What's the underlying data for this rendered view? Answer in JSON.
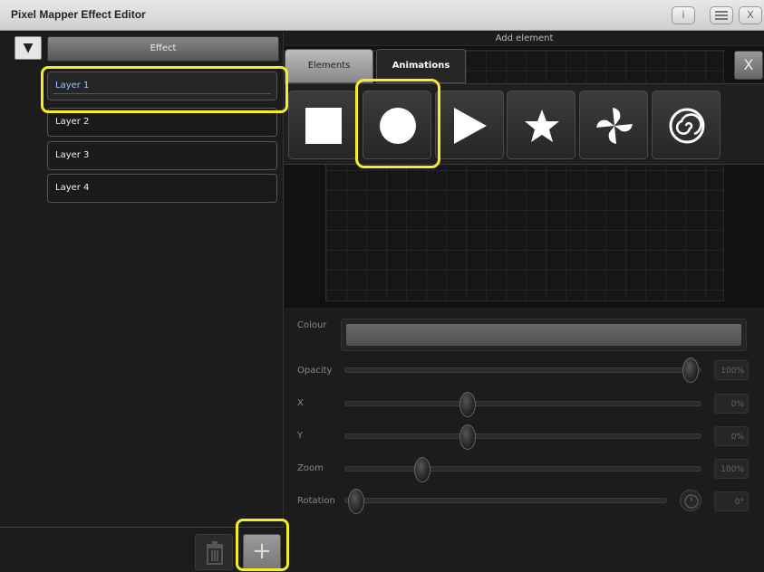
{
  "window": {
    "title": "Pixel Mapper Effect Editor",
    "info_button": "i",
    "close_button": "X"
  },
  "left": {
    "collapse_icon": "triangle-down-icon",
    "effect_tab": "Effect",
    "layers": [
      "Layer 1",
      "Layer 2",
      "Layer 3",
      "Layer 4"
    ],
    "selected_layer": "Layer 1",
    "add_button": "+"
  },
  "right": {
    "header": "Add element",
    "tabs": {
      "elements": "Elements",
      "animations": "Animations"
    },
    "close_label": "X",
    "shapes": [
      "square-icon",
      "circle-icon",
      "triangle-icon",
      "star-icon",
      "pinwheel-icon",
      "spiral-icon"
    ],
    "highlighted_shape": "circle-icon"
  },
  "properties": {
    "colour_label": "Colour",
    "opacity": {
      "label": "Opacity",
      "value": "100%",
      "level": 1.0
    },
    "x": {
      "label": "X",
      "value": "0%",
      "level": 0.34
    },
    "y": {
      "label": "Y",
      "value": "0%",
      "level": 0.34
    },
    "zoom": {
      "label": "Zoom",
      "value": "100%",
      "level": 0.21
    },
    "rotation": {
      "label": "Rotation",
      "value": "0°",
      "level": 0.0
    }
  },
  "colors": {
    "highlight": "#f4ee27"
  }
}
